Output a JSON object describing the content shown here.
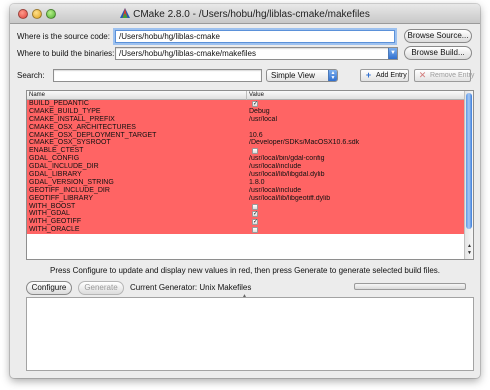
{
  "window": {
    "title": "CMake 2.8.0 - /Users/hobu/hg/liblas-cmake/makefiles"
  },
  "source": {
    "label": "Where is the source code:",
    "value": "/Users/hobu/hg/liblas-cmake",
    "browse_label": "Browse Source..."
  },
  "build": {
    "label": "Where to build the binaries:",
    "value": "/Users/hobu/hg/liblas-cmake/makefiles",
    "browse_label": "Browse Build..."
  },
  "search": {
    "label": "Search:",
    "value": ""
  },
  "view_select": {
    "selected": "Simple View"
  },
  "add_entry": {
    "label": "Add Entry",
    "icon": "plus-icon"
  },
  "remove_entry": {
    "label": "Remove Entry",
    "icon": "x-icon"
  },
  "table": {
    "columns": [
      "Name",
      "Value"
    ],
    "row_color": "#ff6464",
    "rows": [
      {
        "name": "BUILD_PEDANTIC",
        "value": "",
        "checkbox": true,
        "checked": true
      },
      {
        "name": "CMAKE_BUILD_TYPE",
        "value": "Debug"
      },
      {
        "name": "CMAKE_INSTALL_PREFIX",
        "value": "/usr/local"
      },
      {
        "name": "CMAKE_OSX_ARCHITECTURES",
        "value": ""
      },
      {
        "name": "CMAKE_OSX_DEPLOYMENT_TARGET",
        "value": "10.6"
      },
      {
        "name": "CMAKE_OSX_SYSROOT",
        "value": "/Developer/SDKs/MacOSX10.6.sdk"
      },
      {
        "name": "ENABLE_CTEST",
        "value": "",
        "checkbox": true,
        "checked": false
      },
      {
        "name": "GDAL_CONFIG",
        "value": "/usr/local/bin/gdal-config"
      },
      {
        "name": "GDAL_INCLUDE_DIR",
        "value": "/usr/local/include"
      },
      {
        "name": "GDAL_LIBRARY",
        "value": "/usr/local/lib/libgdal.dylib"
      },
      {
        "name": "GDAL_VERSION_STRING",
        "value": "1.8.0"
      },
      {
        "name": "GEOTIFF_INCLUDE_DIR",
        "value": "/usr/local/include"
      },
      {
        "name": "GEOTIFF_LIBRARY",
        "value": "/usr/local/lib/libgeotiff.dylib"
      },
      {
        "name": "WITH_BOOST",
        "value": "",
        "checkbox": true,
        "checked": false
      },
      {
        "name": "WITH_GDAL",
        "value": "",
        "checkbox": true,
        "checked": true
      },
      {
        "name": "WITH_GEOTIFF",
        "value": "",
        "checkbox": true,
        "checked": true
      },
      {
        "name": "WITH_ORACLE",
        "value": "",
        "checkbox": true,
        "checked": false
      }
    ]
  },
  "status_message": "Press Configure to update and display new values in red, then press Generate to generate selected build files.",
  "configure_label": "Configure",
  "generate_label": "Generate",
  "current_generator": "Current Generator: Unix Makefiles",
  "progress": 0,
  "output_text": ""
}
